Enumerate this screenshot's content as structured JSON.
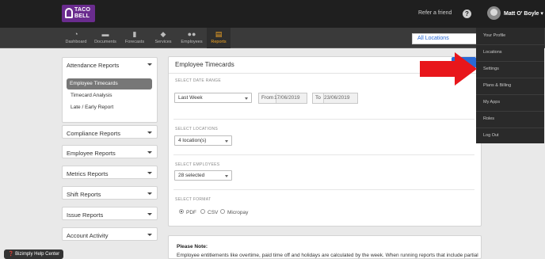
{
  "brand": {
    "logo_text": "TACO\nBELL"
  },
  "header": {
    "refer_link": "Refer a friend",
    "help_icon": "?",
    "user_name": "Matt O' Boyle",
    "location_select": "All Locations"
  },
  "nav": {
    "items": [
      {
        "label": "Dashboard",
        "icon": "dashboard-icon"
      },
      {
        "label": "Documents",
        "icon": "documents-icon"
      },
      {
        "label": "Forecasts",
        "icon": "forecasts-icon"
      },
      {
        "label": "Services",
        "icon": "services-icon"
      },
      {
        "label": "Employees",
        "icon": "employees-icon"
      },
      {
        "label": "Reports",
        "icon": "reports-icon"
      }
    ],
    "active": "Reports"
  },
  "user_menu": {
    "items": [
      "Your Profile",
      "Locations",
      "Settings",
      "Plans & Billing",
      "My Apps",
      "Roles",
      "Log Out"
    ]
  },
  "sidebar": {
    "sections": [
      {
        "title": "Attendance Reports",
        "items": [
          "Employee Timecards",
          "Timecard Analysis",
          "Late / Early Report"
        ]
      },
      {
        "title": "Compliance Reports"
      },
      {
        "title": "Employee Reports"
      },
      {
        "title": "Metrics Reports"
      },
      {
        "title": "Shift Reports"
      },
      {
        "title": "Issue Reports"
      },
      {
        "title": "Account Activity"
      }
    ]
  },
  "main": {
    "title": "Employee Timecards",
    "date_range": {
      "label": "SELECT DATE RANGE",
      "value": "Last Week",
      "from_prefix": "From",
      "from_value": "17/06/2019",
      "to_prefix": "To",
      "to_value": "23/06/2019"
    },
    "locations": {
      "label": "SELECT LOCATIONS",
      "value": "4 location(s)"
    },
    "employees": {
      "label": "SELECT EMPLOYEES",
      "value": "28 selected"
    },
    "format": {
      "label": "SELECT FORMAT",
      "options": [
        "PDF",
        "CSV",
        "Micropay"
      ],
      "selected": "PDF"
    }
  },
  "note": {
    "title": "Please Note:",
    "body": "Employee entitlements like overtime, paid time off and holidays are calculated by the week. When running reports that include partial"
  },
  "help_center": {
    "label": "Bizimply Help Center"
  },
  "colors": {
    "accent_orange": "#f5a623",
    "link_blue": "#2a6ad5",
    "arrow_red": "#e8161b",
    "brand_purple": "#6a2c8e"
  }
}
